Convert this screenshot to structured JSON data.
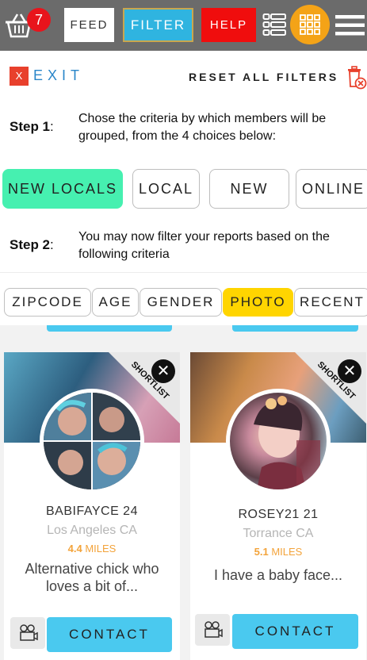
{
  "topbar": {
    "cart_count": "7",
    "feed_label": "FEED",
    "filter_label": "FILTER",
    "help_label": "HELP",
    "icons": [
      "basket-icon",
      "list-icon",
      "grid-icon",
      "hamburger-icon"
    ],
    "colors": {
      "bar": "#6b6b6b",
      "filter": "#2fb4e0",
      "help": "#f00d0d",
      "grid": "#f4a317",
      "badge": "#e8141c"
    }
  },
  "filter": {
    "exit_x": "X",
    "exit_label": "EXIT",
    "reset_label": "RESET ALL FILTERS",
    "step1_label": "Step 1",
    "step1_text": "Chose the criteria by which members will be grouped, from the 4 choices below:",
    "groups": [
      "NEW LOCALS",
      "LOCAL",
      "NEW",
      "ONLINE"
    ],
    "active_group": "NEW LOCALS",
    "step2_label": "Step 2",
    "step2_text": "You may now filter your reports based on the following criteria",
    "criteria": [
      "ZIPCODE",
      "AGE",
      "GENDER",
      "PHOTO",
      "RECENT"
    ],
    "active_criteria": "PHOTO",
    "colors": {
      "group_active": "#46f0b0",
      "criteria_active": "#ffd500",
      "exit": "#2a86c9"
    }
  },
  "cards": [
    {
      "name": "BABIFAYCE 24",
      "location": "Los Angeles CA",
      "distance": "4.4",
      "distance_unit": "MILES",
      "description": "Alternative chick who loves a bit of...",
      "ribbon": "SHORTLIST",
      "contact_label": "CONTACT"
    },
    {
      "name": "ROSEY21 21",
      "location": "Torrance CA",
      "distance": "5.1",
      "distance_unit": "MILES",
      "description": "I have a baby face...",
      "ribbon": "SHORTLIST",
      "contact_label": "CONTACT"
    }
  ]
}
